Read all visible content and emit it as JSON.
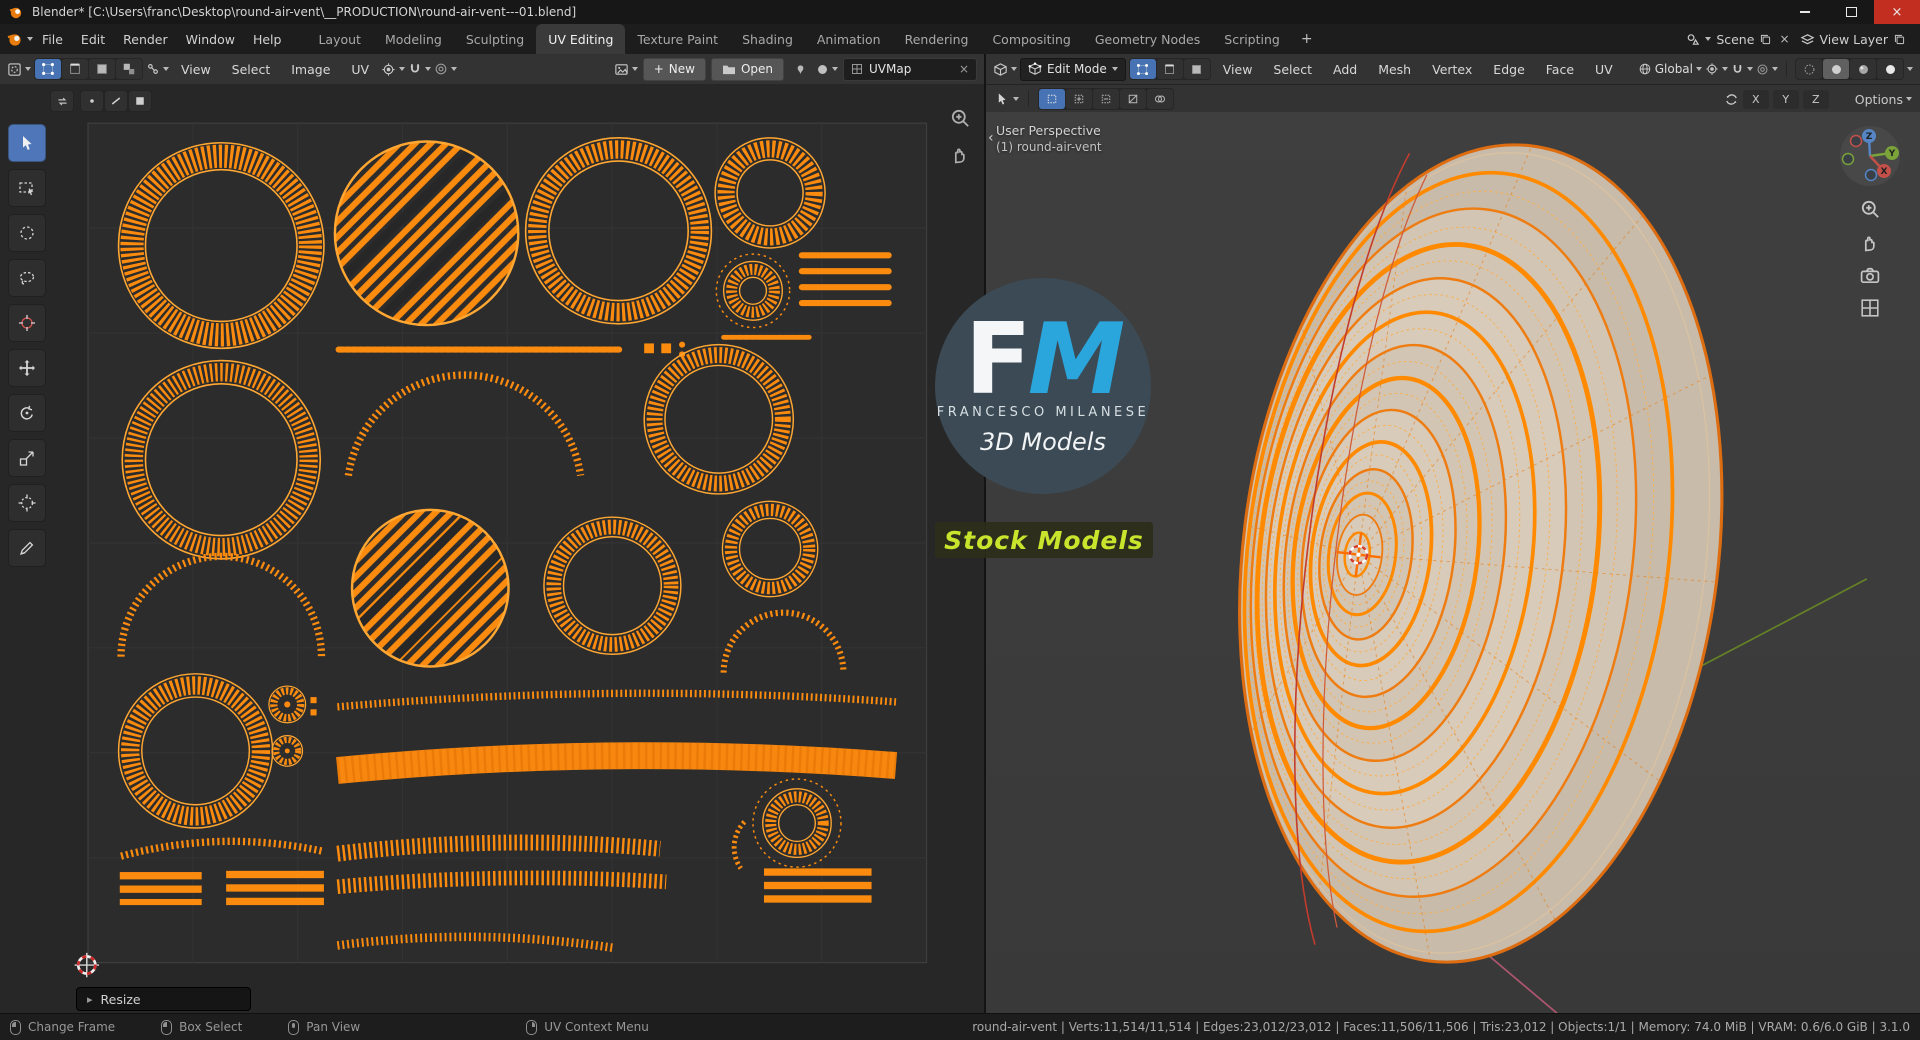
{
  "window": {
    "title": "Blender* [C:\\Users\\franc\\Desktop\\round-air-vent\\__PRODUCTION\\round-air-vent---01.blend]"
  },
  "icons": {
    "close_x": "×",
    "clear_x": "×",
    "plus": "+",
    "resize_caret": "▸",
    "divider_caret": "‹"
  },
  "topbar": {
    "menus": [
      "File",
      "Edit",
      "Render",
      "Window",
      "Help"
    ],
    "tabs": [
      "Layout",
      "Modeling",
      "Sculpting",
      "UV Editing",
      "Texture Paint",
      "Shading",
      "Animation",
      "Rendering",
      "Compositing",
      "Geometry Nodes",
      "Scripting"
    ],
    "add_tab": "+",
    "scene": "Scene",
    "view_layer": "View Layer"
  },
  "uv": {
    "menus": [
      "View",
      "Select",
      "Image",
      "UV"
    ],
    "new_label": "New",
    "open_label": "Open",
    "uvmap": "UVMap",
    "resize": "Resize"
  },
  "v3d": {
    "mode": "Edit Mode",
    "menus": [
      "View",
      "Select",
      "Add",
      "Mesh",
      "Vertex",
      "Edge",
      "Face",
      "UV"
    ],
    "orientation": "Global",
    "mirror": [
      "X",
      "Y",
      "Z"
    ],
    "options": "Options",
    "perspective": "User Perspective",
    "object": "(1) round-air-vent",
    "gizmo": {
      "x": "X",
      "y": "Y",
      "z": "Z"
    }
  },
  "watermark": {
    "f": "F",
    "m": "M",
    "name": "FRANCESCO MILANESE",
    "tagline": "3D Models",
    "badge": "Stock Models"
  },
  "status": {
    "left": [
      "Change Frame",
      "Box Select",
      "Pan View",
      "UV Context Menu"
    ],
    "stats": "round-air-vent | Verts:11,514/11,514 | Edges:23,012/23,012 | Faces:11,506/11,506 | Tris:23,012 | Objects:1/1 | Memory: 74.0 MiB | VRAM: 0.6/6.0 GiB | 3.1.0"
  },
  "colors": {
    "accent_orange": "#fb8b0e",
    "selection_blue": "#4772b3",
    "watermark_blue": "#2ba6dd",
    "badge_green": "#c9e42c"
  }
}
